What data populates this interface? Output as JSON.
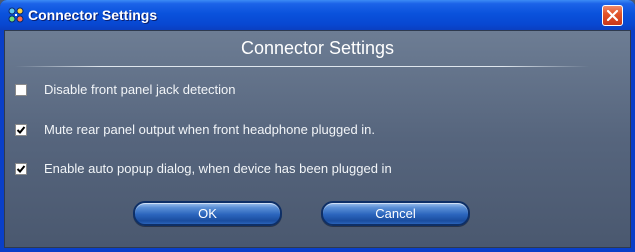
{
  "window": {
    "title": "Connector Settings"
  },
  "dialog": {
    "heading": "Connector Settings",
    "options": [
      {
        "label": "Disable front panel jack detection",
        "checked": false
      },
      {
        "label": "Mute rear panel output when front headphone plugged in.",
        "checked": true
      },
      {
        "label": "Enable auto popup dialog, when device has been plugged in",
        "checked": true
      }
    ],
    "buttons": {
      "ok_label": "OK",
      "cancel_label": "Cancel"
    }
  },
  "icons": {
    "app": "audio-manager-icon",
    "close": "close-icon",
    "check": "checkmark-icon"
  },
  "colors": {
    "titlebar": "#0a52dc",
    "close_button": "#e2552a",
    "client_background": "#5d6c84",
    "button": "#2b65bd"
  }
}
